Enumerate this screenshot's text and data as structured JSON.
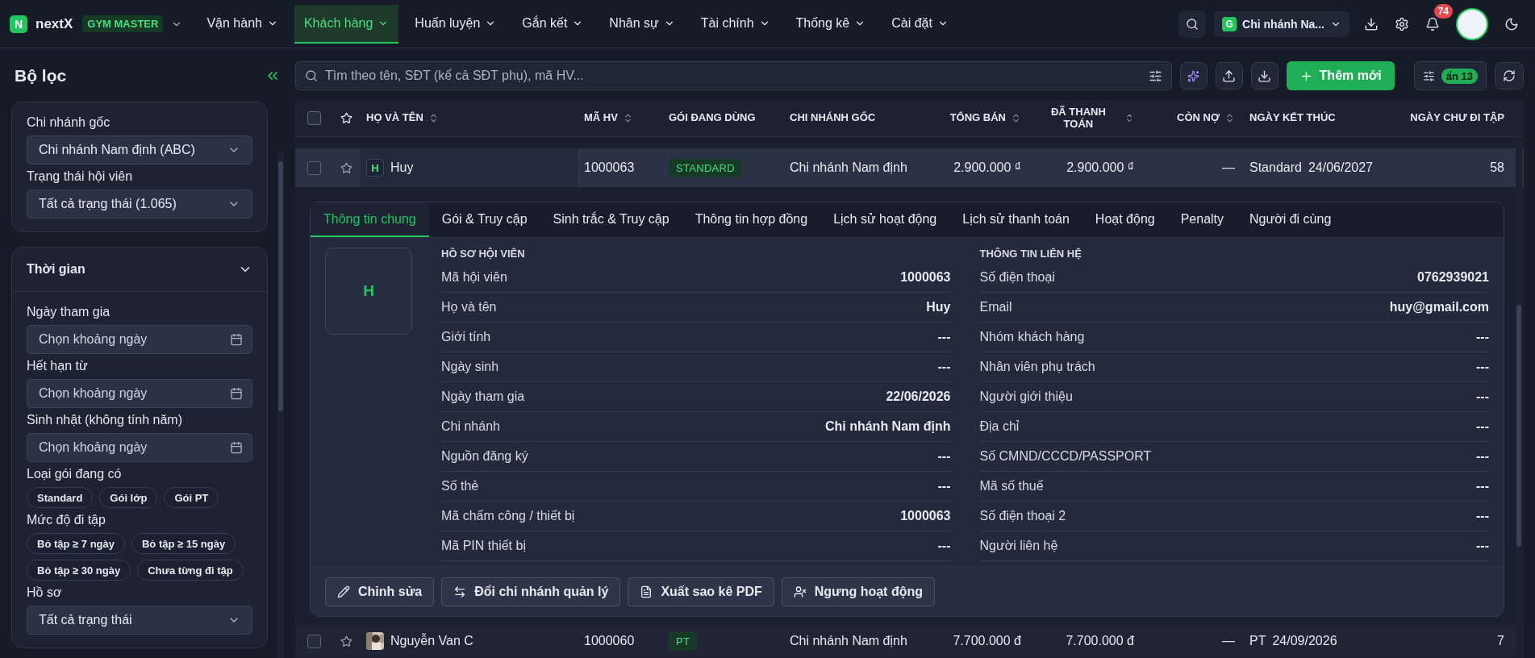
{
  "topbar": {
    "logo": "N",
    "brand": "nextX",
    "edition": "GYM MASTER",
    "menu": [
      {
        "label": "Vận hành",
        "selected": false
      },
      {
        "label": "Khách hàng",
        "selected": true
      },
      {
        "label": "Huấn luyện",
        "selected": false
      },
      {
        "label": "Gắn kết",
        "selected": false
      },
      {
        "label": "Nhân sự",
        "selected": false
      },
      {
        "label": "Tài chính",
        "selected": false
      },
      {
        "label": "Thống kê",
        "selected": false
      },
      {
        "label": "Cài đặt",
        "selected": false
      }
    ],
    "branch": {
      "initial": "G",
      "label": "Chi nhánh Na..."
    },
    "notifications": "74"
  },
  "sidebar": {
    "title": "Bộ lọc",
    "top_card": [
      {
        "label": "Chi nhánh gốc",
        "value": "Chi nhánh Nam định (ABC)"
      },
      {
        "label": "Trạng thái hội viên",
        "value": "Tất cả trạng thái (1.065)"
      }
    ],
    "time_card": {
      "title": "Thời gian",
      "expanded": true,
      "items": [
        {
          "kind": "date",
          "label": "Ngày tham gia",
          "placeholder": "Chọn khoảng ngày"
        },
        {
          "kind": "date",
          "label": "Hết hạn từ",
          "placeholder": "Chọn khoảng ngày"
        },
        {
          "kind": "date",
          "label": "Sinh nhật (không tính năm)",
          "placeholder": "Chọn khoảng ngày"
        },
        {
          "kind": "chips",
          "label": "Loại gói đang có",
          "chips": [
            "Standard",
            "Gói lớp",
            "Gói PT"
          ]
        },
        {
          "kind": "chips",
          "label": "Mức độ đi tập",
          "chips": [
            "Bỏ tập ≥ 7 ngày",
            "Bỏ tập ≥ 15 ngày",
            "Bỏ tập ≥ 30 ngày",
            "Chưa từng đi tập"
          ]
        },
        {
          "kind": "select",
          "label": "Hồ sơ",
          "value": "Tất cả trạng thái"
        }
      ]
    }
  },
  "toolbar": {
    "search_placeholder": "Tìm theo tên, SĐT (kể cả SĐT phụ), mã HV...",
    "add_button": "Thêm mới",
    "hidden_count": "ẩn 13"
  },
  "table": {
    "select_all": {
      "checked": false
    },
    "columns": [
      {
        "label": "HỌ VÀ TÊN",
        "sortable": true
      },
      {
        "label": "MÃ HV",
        "sortable": true
      },
      {
        "label": "GÓI ĐANG DÙNG",
        "sortable": false
      },
      {
        "label": "CHI NHÁNH GỐC",
        "sortable": false
      },
      {
        "label": "TỔNG BÁN",
        "sortable": true
      },
      {
        "label": "ĐÃ THANH TOÁN",
        "sortable": true
      },
      {
        "label": "CÒN NỢ",
        "sortable": true
      },
      {
        "label": "NGÀY KẾT THÚC",
        "sortable": false
      },
      {
        "label": "NGÀY CHƯ ĐI TẬP",
        "sortable": false
      }
    ],
    "rows": [
      {
        "checked": false,
        "avatar": {
          "kind": "initial",
          "text": "H"
        },
        "name": "Huy",
        "code": "1000063",
        "package": "STANDARD",
        "branch": "Chi nhánh Nam định",
        "total": "2.900.000 ₫",
        "paid": "2.900.000 ₫",
        "debt": "—",
        "end_type": "Standard",
        "end_date": "24/06/2027",
        "days": "58",
        "expanded": true
      },
      {
        "checked": false,
        "name": "Nguyễn Van C",
        "code": "1000060",
        "package": "PT",
        "branch": "Chi nhánh Nam định",
        "total": "7.700.000 đ",
        "paid": "7.700.000 đ",
        "debt": "—",
        "end_type": "PT",
        "end_date": "24/09/2026",
        "days": "7",
        "expanded": false
      }
    ]
  },
  "detail": {
    "tabs": [
      {
        "label": "Thông tin chung",
        "selected": true
      },
      {
        "label": "Gói & Truy cập",
        "selected": false
      },
      {
        "label": "Sinh trắc & Truy cập",
        "selected": false
      },
      {
        "label": "Thông tin hợp đồng",
        "selected": false
      },
      {
        "label": "Lịch sử hoạt động",
        "selected": false
      },
      {
        "label": "Lịch sử thanh toán",
        "selected": false
      },
      {
        "label": "Hoạt động",
        "selected": false
      },
      {
        "label": "Penalty",
        "selected": false
      },
      {
        "label": "Người đi cùng",
        "selected": false
      }
    ],
    "avatar": "H",
    "sections": [
      {
        "title": "HỒ SƠ HỘI VIÊN",
        "rows": [
          [
            "Mã hội viên",
            "1000063"
          ],
          [
            "Họ và tên",
            "Huy"
          ],
          [
            "Giới tính",
            "---"
          ],
          [
            "Ngày sinh",
            "---"
          ],
          [
            "Ngày tham gia",
            "22/06/2026"
          ],
          [
            "Chi nhánh",
            "Chi nhánh Nam định"
          ],
          [
            "Nguồn đăng ký",
            "---"
          ],
          [
            "Số thẻ",
            "---"
          ],
          [
            "Mã chấm công / thiết bị",
            "1000063"
          ],
          [
            "Mã PIN thiết bị",
            "---"
          ]
        ]
      },
      {
        "title": "THÔNG TIN LIÊN HỆ",
        "rows": [
          [
            "Số điện thoại",
            "0762939021"
          ],
          [
            "Email",
            "huy@gmail.com"
          ],
          [
            "Nhóm khách hàng",
            "---"
          ],
          [
            "Nhân viên phụ trách",
            "---"
          ],
          [
            "Người giới thiệu",
            "---"
          ],
          [
            "Địa chỉ",
            "---"
          ],
          [
            "Số CMND/CCCD/PASSPORT",
            "---"
          ],
          [
            "Mã số thuế",
            "---"
          ],
          [
            "Số điện thoại 2",
            "---"
          ],
          [
            "Người liên hệ",
            "---"
          ]
        ]
      }
    ],
    "actions": [
      {
        "kind": "edit",
        "label": "Chỉnh sửa"
      },
      {
        "kind": "transfer",
        "label": "Đổi chi nhánh quản lý"
      },
      {
        "kind": "pdf",
        "label": "Xuất sao kê PDF"
      },
      {
        "kind": "deactivate",
        "label": "Ngưng hoạt động"
      }
    ]
  }
}
